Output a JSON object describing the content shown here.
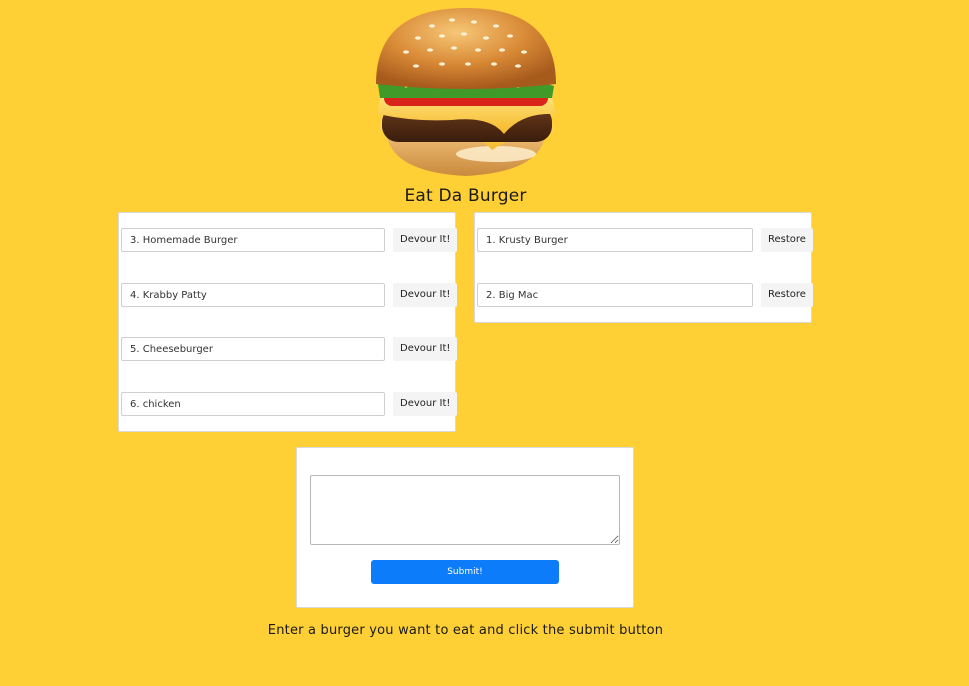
{
  "header": {
    "title": "Eat Da Burger"
  },
  "logo": {
    "icon": "burger-icon"
  },
  "uneaten": {
    "button_label": "Devour It!",
    "items": [
      {
        "label": "3. Homemade Burger"
      },
      {
        "label": "4. Krabby Patty"
      },
      {
        "label": "5. Cheeseburger"
      },
      {
        "label": "6. chicken"
      }
    ]
  },
  "devoured": {
    "button_label": "Restore",
    "items": [
      {
        "label": "1. Krusty Burger"
      },
      {
        "label": "2. Big Mac"
      }
    ]
  },
  "form": {
    "textarea_value": "",
    "submit_label": "Submit!"
  },
  "footer": {
    "instructions": "Enter a burger you want to eat and click the submit button"
  },
  "colors": {
    "background": "#ffd035",
    "submit_button": "#0d7cfb"
  }
}
